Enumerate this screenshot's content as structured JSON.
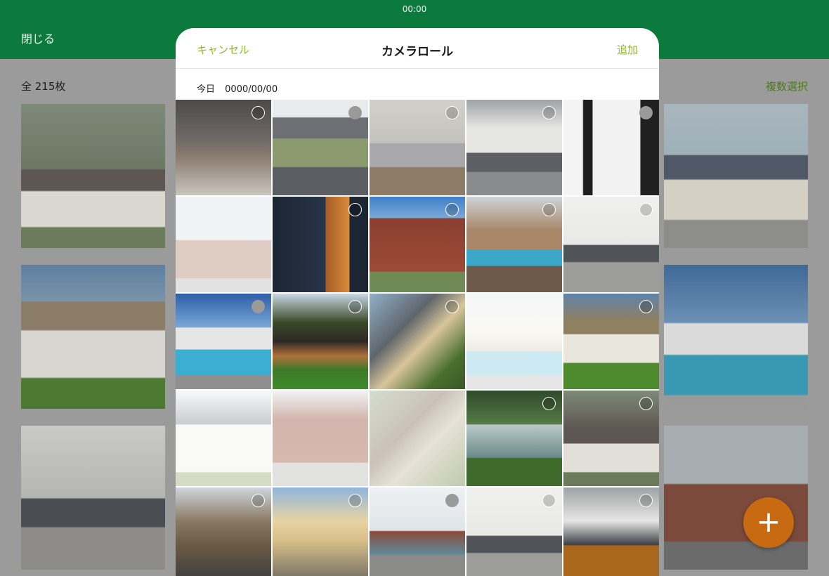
{
  "status": {
    "time": "00:00"
  },
  "header": {
    "close_label": "閉じる"
  },
  "toolbar": {
    "total": "全 215枚",
    "multi_select": "複数選択"
  },
  "sheet": {
    "cancel": "キャンセル",
    "title": "カメラロール",
    "add": "追加",
    "date_label": "今日",
    "date_value": "0000/00/00"
  },
  "fab": {
    "label": "+"
  },
  "colors": {
    "header": "#0b7a3c",
    "accent": "#8bb82c",
    "fab": "#c76a12"
  }
}
